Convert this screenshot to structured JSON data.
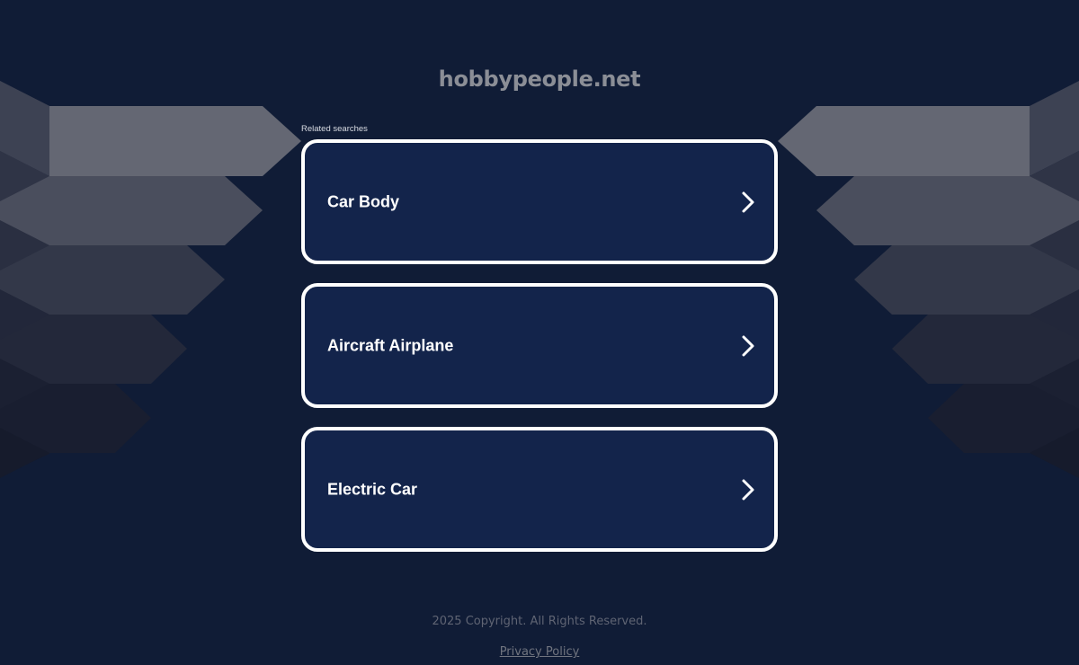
{
  "header": {
    "domain": "hobbypeople.net"
  },
  "related": {
    "label": "Related searches",
    "items": [
      {
        "label": "Car Body"
      },
      {
        "label": "Aircraft Airplane"
      },
      {
        "label": "Electric Car"
      }
    ]
  },
  "footer": {
    "copyright": "2025 Copyright. All Rights Reserved.",
    "privacy_label": "Privacy Policy"
  },
  "colors": {
    "background": "#101c36",
    "card_background": "#13244b",
    "card_border": "#ffffff",
    "title_text": "#8b8e96"
  },
  "icons": {
    "card_arrow": "chevron-right-icon"
  }
}
